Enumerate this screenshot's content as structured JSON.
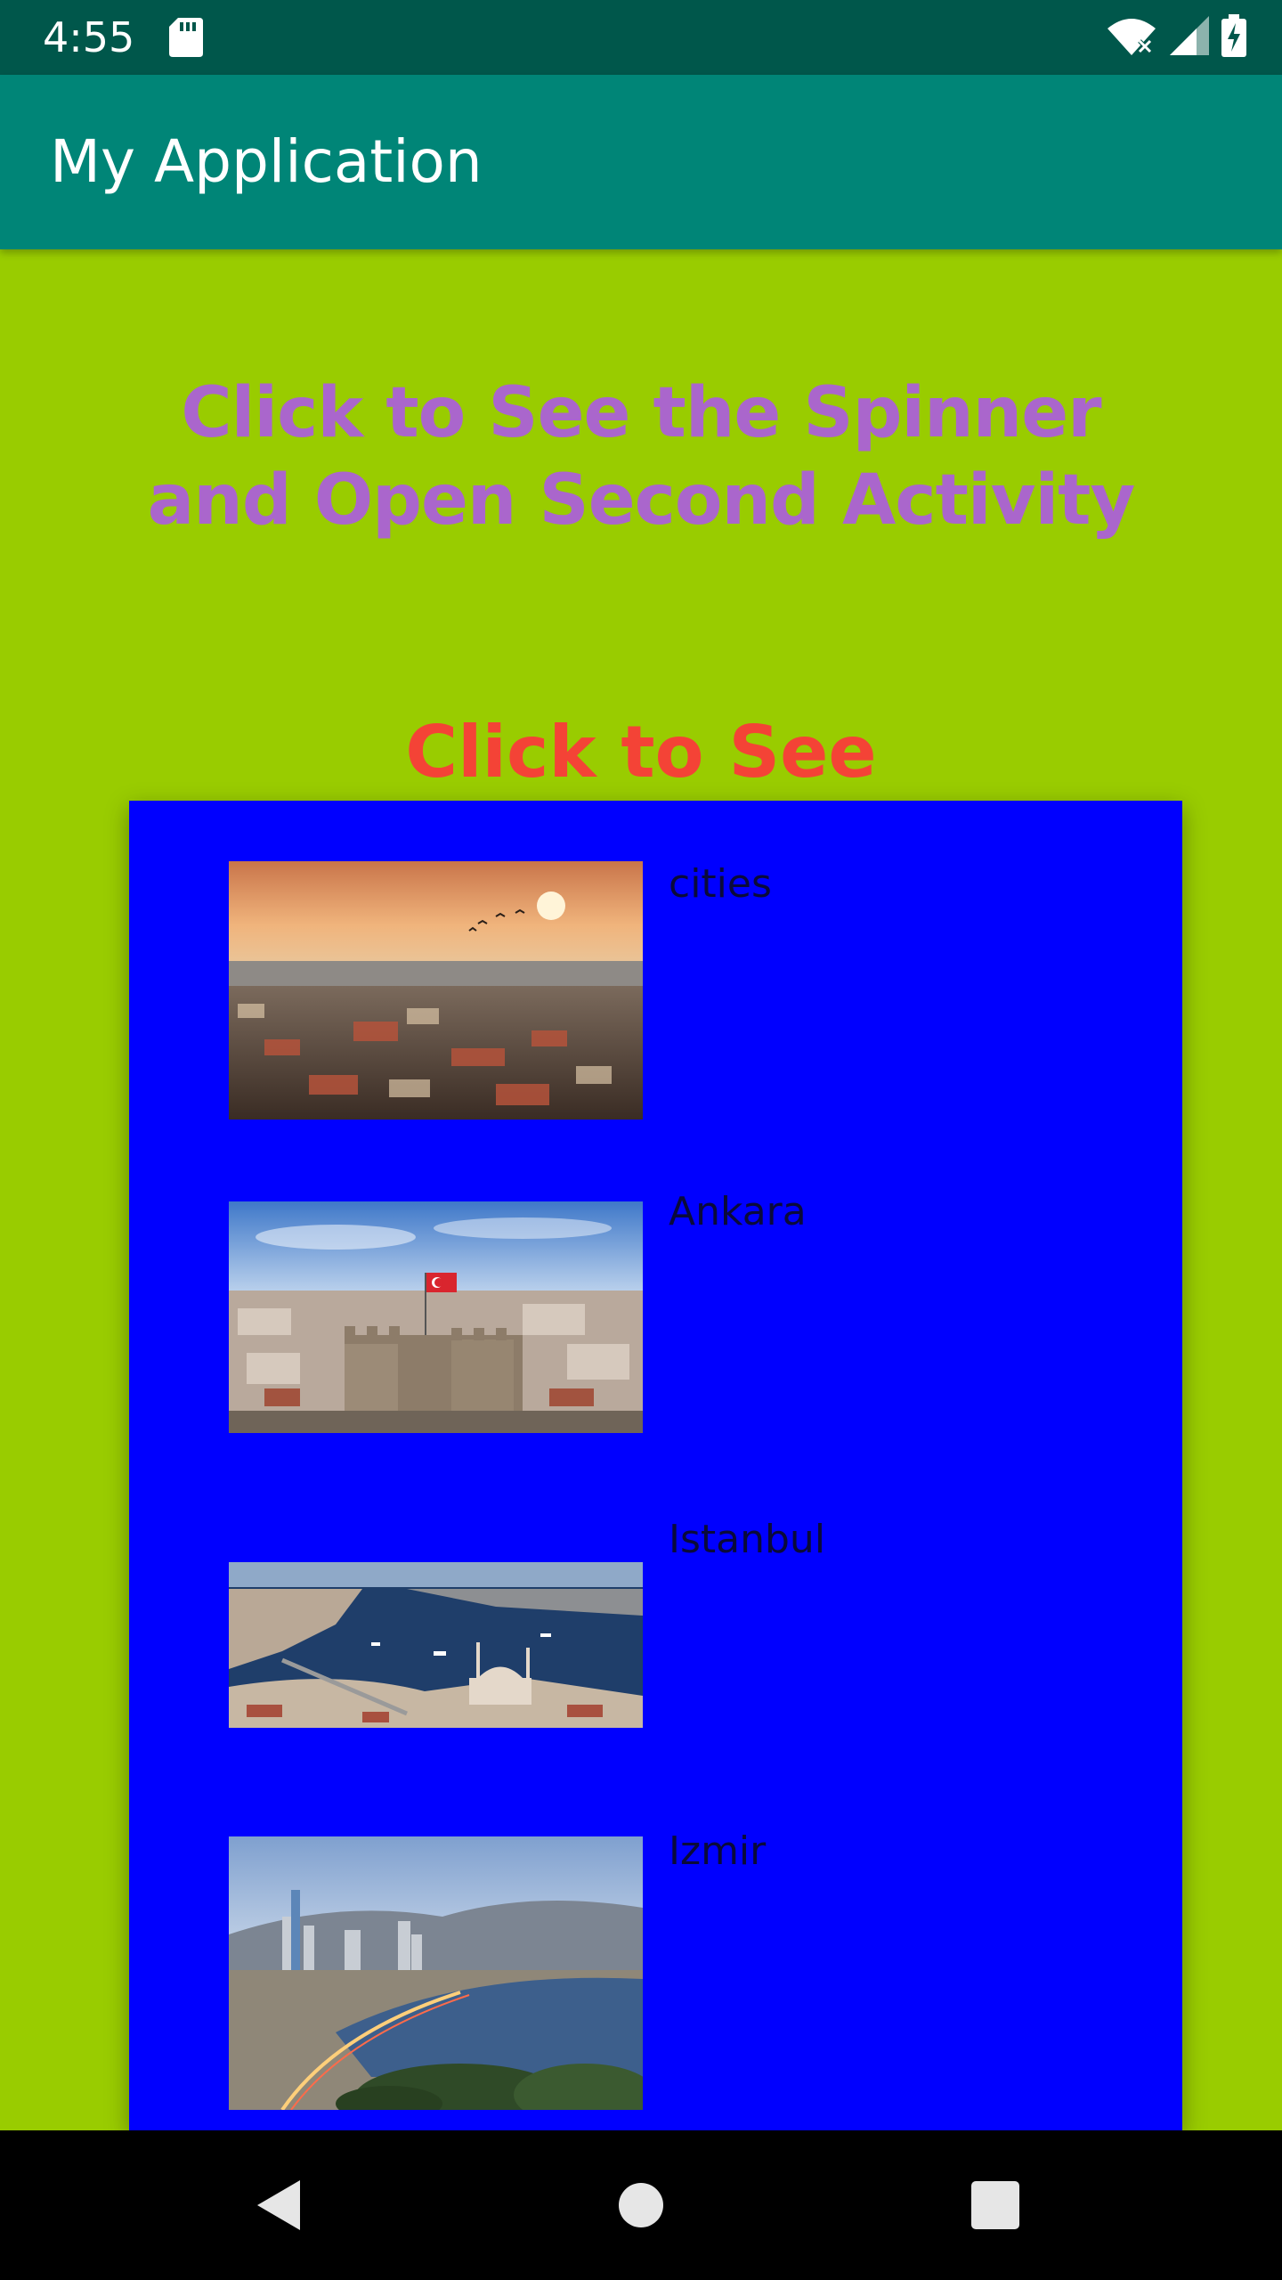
{
  "status_bar": {
    "time": "4:55",
    "icons": [
      "sd-card-icon",
      "wifi-icon",
      "signal-icon",
      "battery-charging-icon"
    ]
  },
  "app_bar": {
    "title": "My Application"
  },
  "main": {
    "heading": "Click to See the Spinner and Open Second Activity",
    "spinner_label": "Click to See"
  },
  "dropdown": {
    "items": [
      {
        "label": "cities",
        "image": "istanbul-sunset-image"
      },
      {
        "label": "Ankara",
        "image": "ankara-castle-image"
      },
      {
        "label": "Istanbul",
        "image": "istanbul-bosphorus-image"
      },
      {
        "label": "Izmir",
        "image": "izmir-bay-image"
      }
    ]
  },
  "nav_bar": {
    "icons": [
      "back-icon",
      "home-icon",
      "recents-icon"
    ]
  },
  "colors": {
    "background": "#99CC00",
    "status_bar": "#00574B",
    "app_bar": "#008577",
    "heading": "#AA66CC",
    "spinner_label": "#F44336",
    "dropdown": "#0000FF"
  }
}
